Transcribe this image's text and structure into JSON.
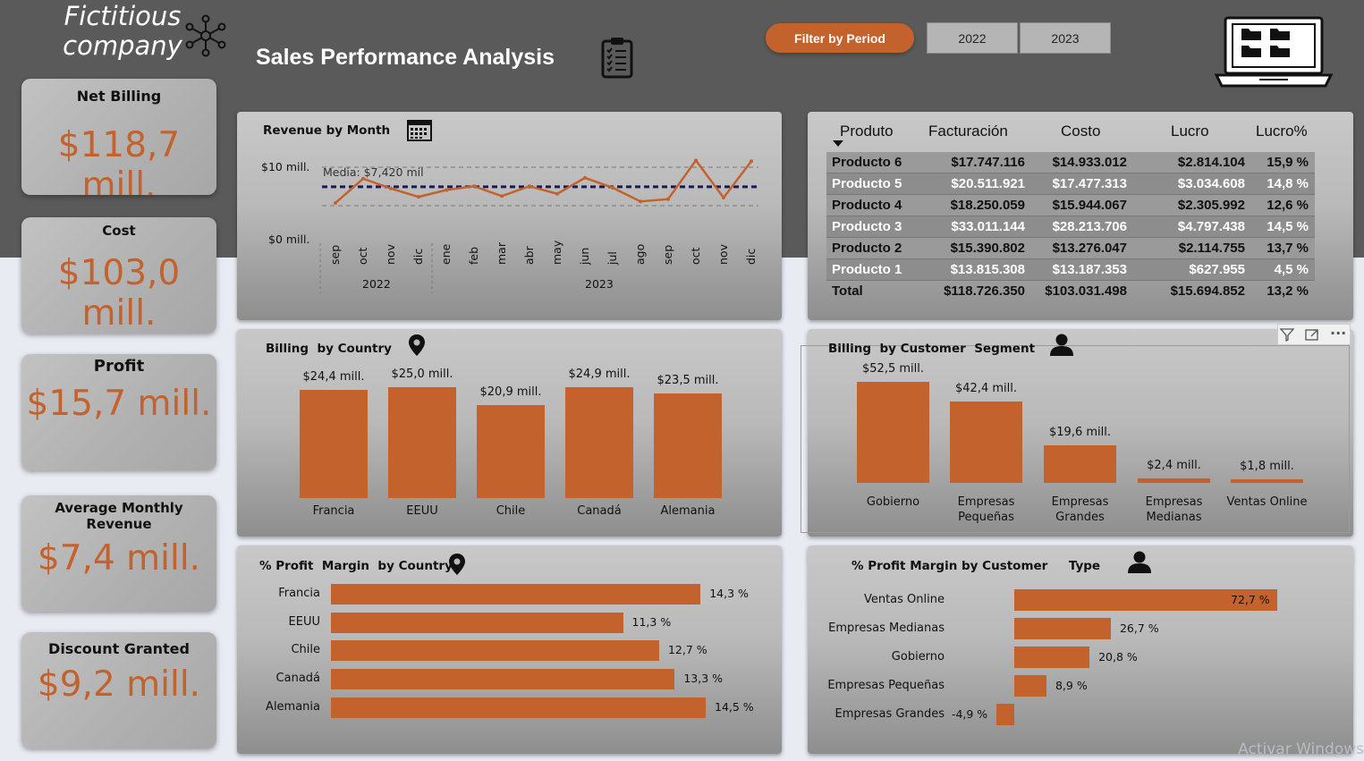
{
  "header": {
    "brand": "Fictitious company",
    "title": "Sales Performance Analysis",
    "filter_label": "Filter by Period",
    "years": [
      "2022",
      "2023"
    ]
  },
  "kpis": {
    "net_billing": {
      "label": "Net Billing",
      "value": "$118,7 mill."
    },
    "cost": {
      "label": "Cost",
      "value": "$103,0 mill."
    },
    "profit": {
      "label": "Profit",
      "value": "$15,7 mill."
    },
    "avg_monthly": {
      "label": "Average Monthly Revenue",
      "value": "$7,4 mill."
    },
    "discount": {
      "label": "Discount Granted",
      "value": "$9,2 mill."
    }
  },
  "revenue_month": {
    "title": "Revenue by Month",
    "y_ticks": [
      "$10 mill.",
      "$0 mill."
    ],
    "average_label": "Media: $7,420 mil",
    "months": [
      "sep",
      "oct",
      "nov",
      "dic",
      "ene",
      "feb",
      "mar",
      "abr",
      "may",
      "jun",
      "jul",
      "ago",
      "sep",
      "oct",
      "nov",
      "dic"
    ],
    "years": [
      "2022",
      "2023"
    ]
  },
  "table": {
    "headers": [
      "Produto",
      "Facturación",
      "Costo",
      "Lucro",
      "Lucro%"
    ],
    "rows": [
      [
        "Producto 6",
        "$17.747.116",
        "$14.933.012",
        "$2.814.104",
        "15,9 %"
      ],
      [
        "Producto 5",
        "$20.511.921",
        "$17.477.313",
        "$3.034.608",
        "14,8 %"
      ],
      [
        "Producto 4",
        "$18.250.059",
        "$15.944.067",
        "$2.305.992",
        "12,6 %"
      ],
      [
        "Producto 3",
        "$33.011.144",
        "$28.213.706",
        "$4.797.438",
        "14,5 %"
      ],
      [
        "Producto 2",
        "$15.390.802",
        "$13.276.047",
        "$2.114.755",
        "13,7 %"
      ],
      [
        "Producto 1",
        "$13.815.308",
        "$13.187.353",
        "$627.955",
        "4,5 %"
      ]
    ],
    "total": [
      "Total",
      "$118.726.350",
      "$103.031.498",
      "$15.694.852",
      "13,2 %"
    ]
  },
  "billing_country": {
    "title": "Billing  by Country",
    "labels": [
      "$24,4 mill.",
      "$25,0 mill.",
      "$20,9 mill.",
      "$24,9 mill.",
      "$23,5 mill."
    ],
    "countries": [
      "Francia",
      "EEUU",
      "Chile",
      "Canadá",
      "Alemania"
    ]
  },
  "billing_segment": {
    "title": "Billing  by Customer  Segment",
    "labels": [
      "$52,5 mill.",
      "$42,4 mill.",
      "$19,6 mill.",
      "$2,4 mill.",
      "$1,8 mill."
    ],
    "segments": [
      "Gobierno",
      "Empresas\nPequeñas",
      "Empresas\nGrandes",
      "Empresas\nMedianas",
      "Ventas Online"
    ]
  },
  "margin_country": {
    "title": "% Profit  Margin  by Country",
    "countries": [
      "Francia",
      "EEUU",
      "Chile",
      "Canadá",
      "Alemania"
    ],
    "labels": [
      "14,3 %",
      "11,3 %",
      "12,7 %",
      "13,3 %",
      "14,5 %"
    ]
  },
  "margin_customer": {
    "title": "% Profit Margin by Customer     Type",
    "types": [
      "Ventas Online",
      "Empresas Medianas",
      "Gobierno",
      "Empresas Pequeñas",
      "Empresas Grandes"
    ],
    "labels": [
      "72,7 %",
      "26,7 %",
      "20,8 %",
      "8,9 %",
      "-4,9 %"
    ]
  },
  "watermark": "Activar Windows",
  "chart_data": [
    {
      "type": "line",
      "title": "Revenue by Month",
      "x": [
        "sep 2022",
        "oct 2022",
        "nov 2022",
        "dic 2022",
        "ene 2023",
        "feb 2023",
        "mar 2023",
        "abr 2023",
        "may 2023",
        "jun 2023",
        "jul 2023",
        "ago 2023",
        "sep 2023",
        "oct 2023",
        "nov 2023",
        "dic 2023"
      ],
      "values": [
        5.3,
        8.5,
        7.2,
        6.1,
        7.0,
        7.5,
        6.2,
        7.5,
        6.5,
        8.6,
        7.3,
        5.5,
        5.8,
        10.9,
        6.0,
        10.8
      ],
      "average": 7.42,
      "ylabel": "",
      "xlabel": "",
      "y_ticks": [
        "$0 mill.",
        "$10 mill."
      ],
      "ylim": [
        0,
        11.5
      ]
    },
    {
      "type": "bar",
      "title": "Billing  by Country",
      "categories": [
        "Francia",
        "EEUU",
        "Chile",
        "Canadá",
        "Alemania"
      ],
      "values": [
        24.4,
        25.0,
        20.9,
        24.9,
        23.5
      ]
    },
    {
      "type": "bar",
      "title": "Billing  by Customer  Segment",
      "categories": [
        "Gobierno",
        "Empresas Pequeñas",
        "Empresas Grandes",
        "Empresas Medianas",
        "Ventas Online"
      ],
      "values": [
        52.5,
        42.4,
        19.6,
        2.4,
        1.8
      ]
    },
    {
      "type": "bar",
      "title": "% Profit  Margin  by Country",
      "categories": [
        "Francia",
        "EEUU",
        "Chile",
        "Canadá",
        "Alemania"
      ],
      "values": [
        14.3,
        11.3,
        12.7,
        13.3,
        14.5
      ]
    },
    {
      "type": "bar",
      "title": "% Profit Margin by Customer     Type",
      "categories": [
        "Ventas Online",
        "Empresas Medianas",
        "Gobierno",
        "Empresas Pequeñas",
        "Empresas Grandes"
      ],
      "values": [
        72.7,
        26.7,
        20.8,
        8.9,
        -4.9
      ]
    }
  ]
}
